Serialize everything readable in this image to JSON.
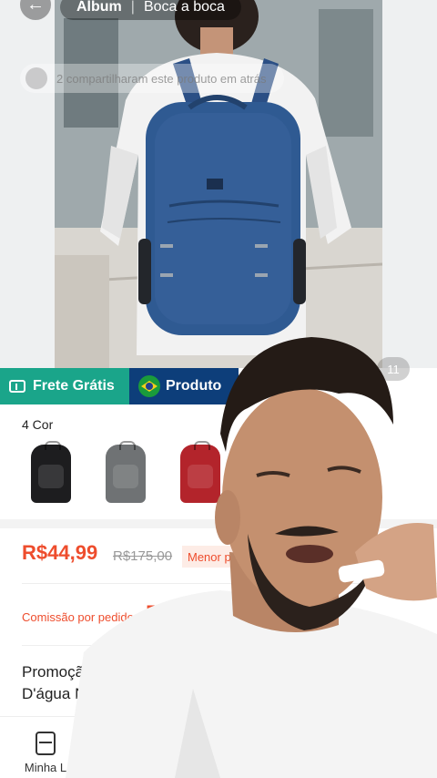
{
  "header": {
    "tabs": [
      {
        "label": "Álbum",
        "active": true
      },
      {
        "label": "Boca a boca",
        "active": false
      }
    ],
    "share_text": "2 compartilharam este produto em atrás",
    "image_counter": "11",
    "icons": {
      "back": "back-arrow-icon"
    }
  },
  "badges": {
    "free_shipping": "Frete Grátis",
    "brazil_product": "Produto"
  },
  "colors": {
    "title": "4 Cor",
    "swatches": [
      {
        "name": "black",
        "color": "#1d1d1f"
      },
      {
        "name": "gray",
        "color": "#6f7274"
      },
      {
        "name": "red",
        "color": "#b3242b"
      }
    ]
  },
  "price": {
    "current": "R$44,99",
    "original": "R$175,00",
    "badge": "Menor preç"
  },
  "commission": {
    "label": "Comissão por pedido",
    "value": "R$5,4"
  },
  "product": {
    "title": "Promoção dia D'água Note"
  },
  "bottom_nav": {
    "store_label": "Minha L"
  },
  "theme": {
    "accent": "#ee4d2d",
    "free_shipping_bg": "#1aa58a",
    "brazil_bg": "#0d3e7a"
  }
}
